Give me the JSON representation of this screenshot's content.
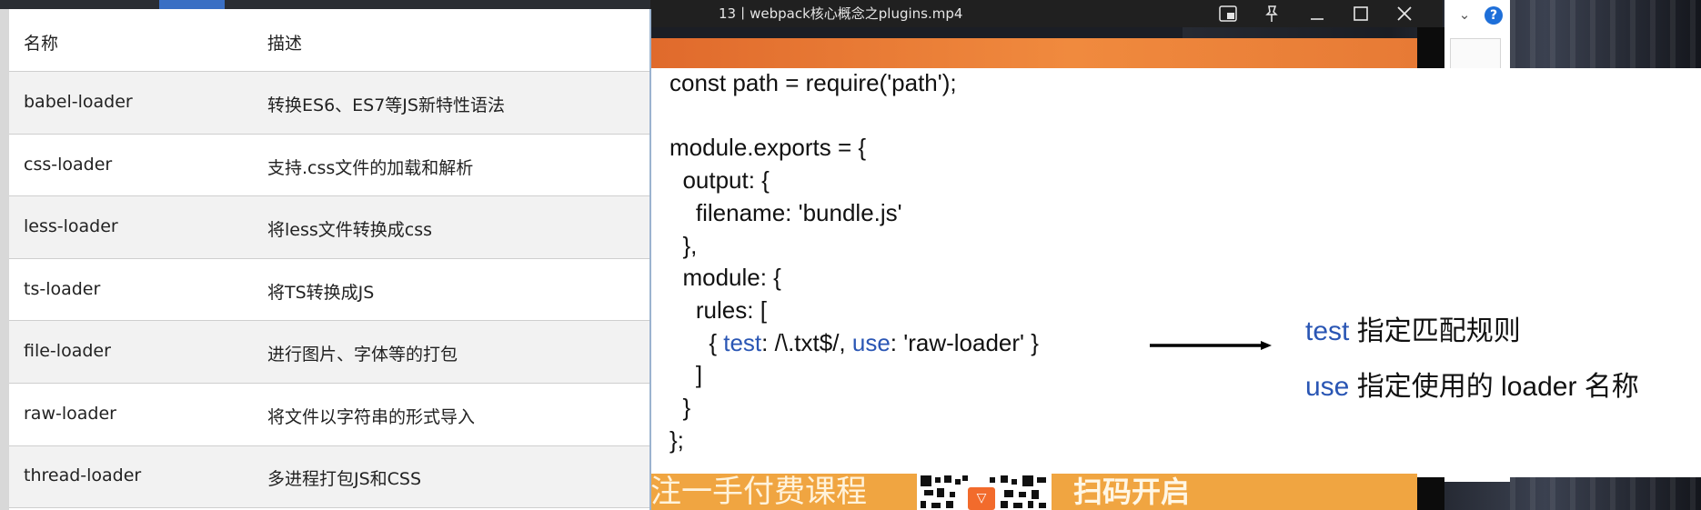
{
  "window": {
    "title": "13丨webpack核心概念之plugins.mp4",
    "controls": [
      "picture-in-picture-icon",
      "pin-icon",
      "minimize-icon",
      "maximize-icon",
      "close-icon"
    ]
  },
  "table": {
    "headers": [
      "名称",
      "描述"
    ],
    "rows": [
      {
        "name": "babel-loader",
        "desc": "转换ES6、ES7等JS新特性语法"
      },
      {
        "name": "css-loader",
        "desc": "支持.css文件的加载和解析"
      },
      {
        "name": "less-loader",
        "desc": "将less文件转换成css"
      },
      {
        "name": "ts-loader",
        "desc": "将TS转换成JS"
      },
      {
        "name": "file-loader",
        "desc": "进行图片、字体等的打包"
      },
      {
        "name": "raw-loader",
        "desc": "将文件以字符串的形式导入"
      },
      {
        "name": "thread-loader",
        "desc": "多进程打包JS和CSS"
      }
    ]
  },
  "code": {
    "line1": "const path = require('path');",
    "line3": "module.exports = {",
    "line4": "  output: {",
    "line5": "    filename: 'bundle.js'",
    "line6": "  },",
    "line7": "  module: {",
    "line8": "    rules: [",
    "line9_pre": "      { ",
    "kw_test": "test",
    "line9_mid": ": /\\.txt$/, ",
    "kw_use": "use",
    "line9_post": ": 'raw-loader' }",
    "line10": "    ]",
    "line11": "  }",
    "line12": "};"
  },
  "annotations": {
    "test_kw": "test",
    "test_desc": " 指定匹配规则",
    "use_kw": "use",
    "use_desc": " 指定使用的 loader 名称"
  },
  "promo": {
    "left": "注一手付费课程",
    "right": "扫码开启"
  },
  "colors": {
    "keyword": "#2a56b4",
    "orange": "#f08a3e",
    "promo_band": "#f0a541"
  }
}
